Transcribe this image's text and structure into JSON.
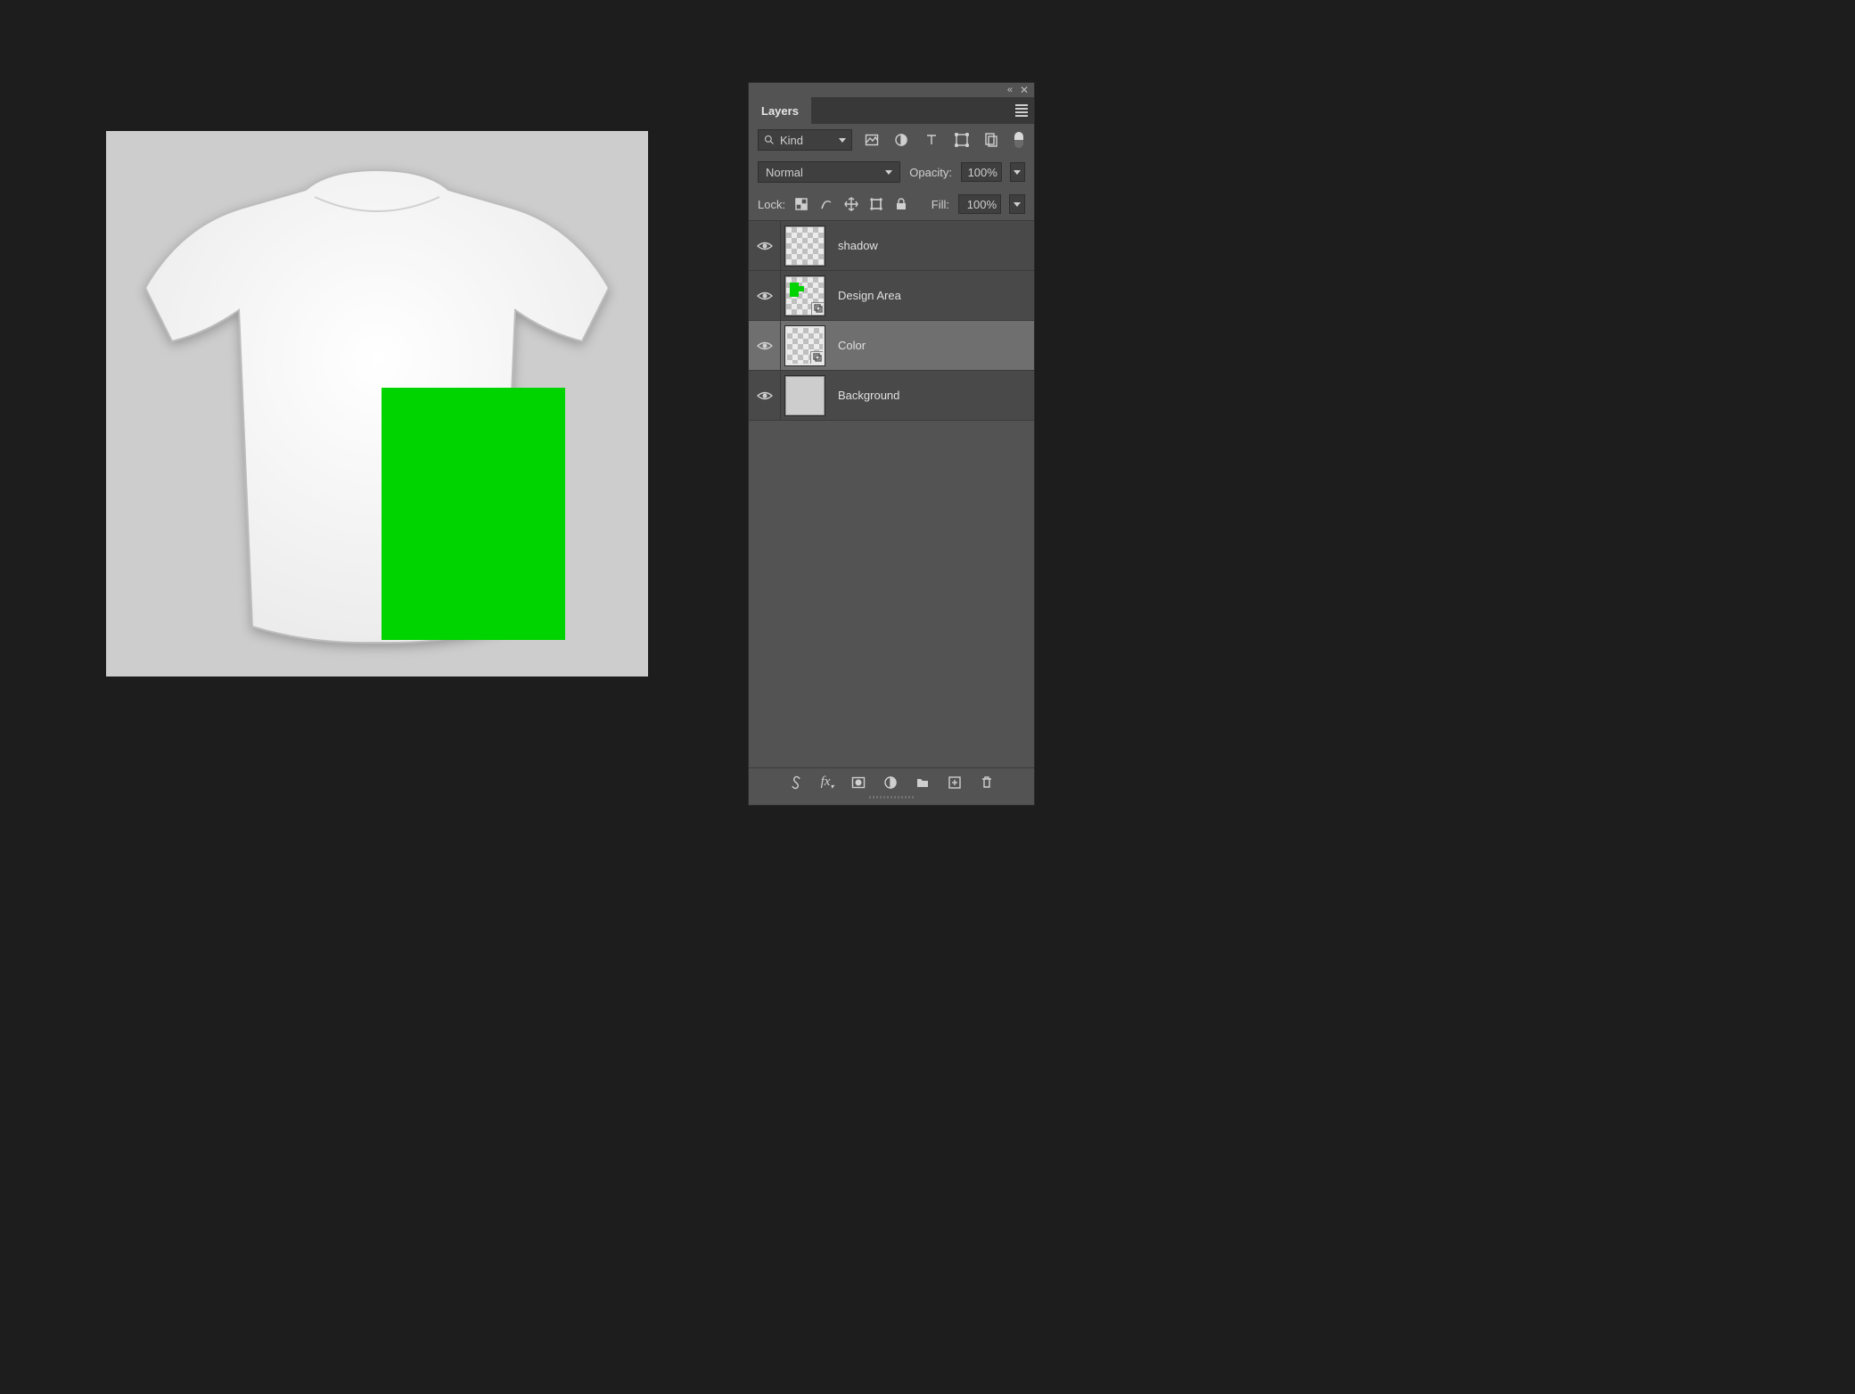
{
  "panel": {
    "tab_label": "Layers",
    "kind_label": "Kind",
    "blend_mode": "Normal",
    "opacity_label": "Opacity:",
    "opacity_value": "100%",
    "lock_label": "Lock:",
    "fill_label": "Fill:",
    "fill_value": "100%"
  },
  "layers": [
    {
      "name": "shadow",
      "visible": true,
      "selected": false,
      "thumb": "checker"
    },
    {
      "name": "Design Area",
      "visible": true,
      "selected": false,
      "thumb": "design",
      "smart": true
    },
    {
      "name": "Color",
      "visible": true,
      "selected": true,
      "thumb": "color",
      "smart": true
    },
    {
      "name": "Background",
      "visible": true,
      "selected": false,
      "thumb": "solid"
    }
  ],
  "canvas": {
    "design_color": "#00d400"
  }
}
